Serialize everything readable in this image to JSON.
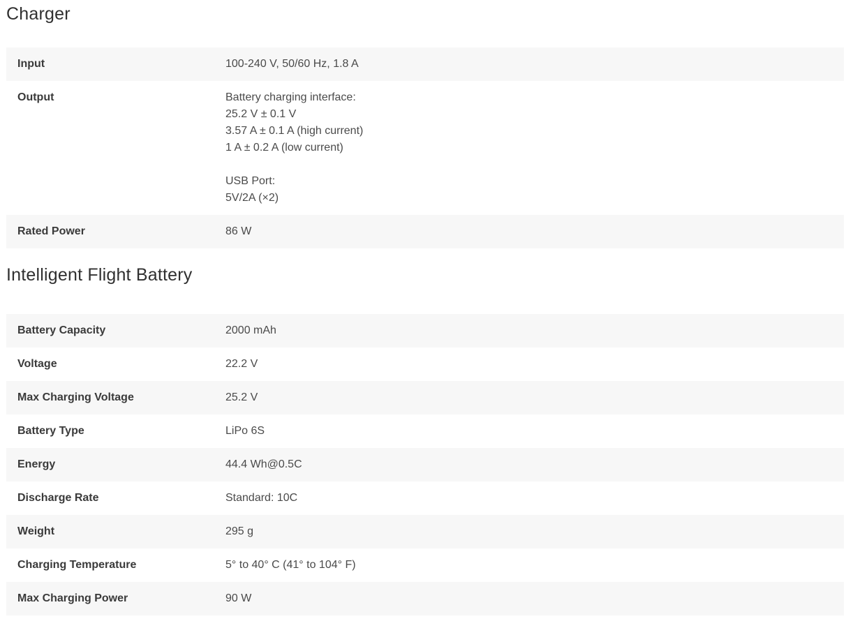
{
  "sections": [
    {
      "title": "Charger",
      "rows": [
        {
          "label": "Input",
          "lines": [
            "100-240 V, 50/60 Hz, 1.8 A"
          ]
        },
        {
          "label": "Output",
          "lines": [
            "Battery charging interface:",
            "25.2 V ± 0.1 V",
            "3.57 A ± 0.1 A (high current)",
            "1 A ± 0.2 A (low current)",
            "",
            "USB Port:",
            "5V/2A (×2)"
          ]
        },
        {
          "label": "Rated Power",
          "lines": [
            "86 W"
          ]
        }
      ]
    },
    {
      "title": "Intelligent Flight Battery",
      "rows": [
        {
          "label": "Battery Capacity",
          "lines": [
            "2000 mAh"
          ]
        },
        {
          "label": "Voltage",
          "lines": [
            "22.2 V"
          ]
        },
        {
          "label": "Max Charging Voltage",
          "lines": [
            "25.2 V"
          ]
        },
        {
          "label": "Battery Type",
          "lines": [
            "LiPo 6S"
          ]
        },
        {
          "label": "Energy",
          "lines": [
            "44.4 Wh@0.5C"
          ]
        },
        {
          "label": "Discharge Rate",
          "lines": [
            "Standard: 10C"
          ]
        },
        {
          "label": "Weight",
          "lines": [
            "295 g"
          ]
        },
        {
          "label": "Charging Temperature",
          "lines": [
            "5° to 40° C (41° to 104° F)"
          ]
        },
        {
          "label": "Max Charging Power",
          "lines": [
            "90 W"
          ]
        }
      ]
    }
  ],
  "colors": {
    "row_stripe": "#f7f7f7",
    "background": "#ffffff",
    "label_text": "#3a3a3a",
    "value_text": "#4a4a4a"
  }
}
